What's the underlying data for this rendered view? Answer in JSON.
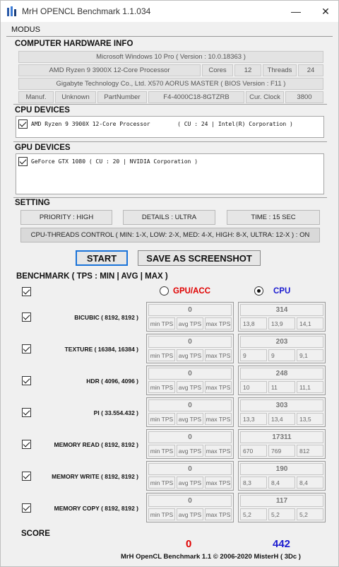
{
  "window": {
    "title": "MrH OPENCL Benchmark 1.1.034",
    "minimize_glyph": "—",
    "close_glyph": "✕"
  },
  "menu": {
    "items": [
      "MODUS"
    ]
  },
  "hardware": {
    "title": "COMPUTER HARDWARE INFO",
    "os": "Microsoft Windows 10 Pro ( Version : 10.0.18363 )",
    "cpu_name": "AMD Ryzen 9 3900X 12-Core Processor",
    "cores_label": "Cores",
    "cores_value": "12",
    "threads_label": "Threads",
    "threads_value": "24",
    "board": "Gigabyte Technology Co., Ltd. X570 AORUS MASTER ( BIOS Version : F11 )",
    "manuf_label": "Manuf.",
    "manuf_value": "Unknown",
    "partnumber_label": "PartNumber",
    "partnumber_value": "F4-4000C18-8GTZRB",
    "clock_label": "Cur. Clock",
    "clock_value": "3800"
  },
  "cpu_devices": {
    "title": "CPU DEVICES",
    "items": [
      "AMD Ryzen 9 3900X 12-Core Processor        ( CU : 24 | Intel(R) Corporation )"
    ]
  },
  "gpu_devices": {
    "title": "GPU DEVICES",
    "items": [
      "GeForce GTX 1080 ( CU : 20 | NVIDIA Corporation )"
    ]
  },
  "setting": {
    "title": "SETTING",
    "priority": "PRIORITY : HIGH",
    "details": "DETAILS : ULTRA",
    "time": "TIME : 15 SEC",
    "cpu_threads": "CPU-THREADS CONTROL ( MIN: 1-X, LOW: 2-X, MED: 4-X, HIGH: 8-X, ULTRA: 12-X ) : ON"
  },
  "actions": {
    "start": "START",
    "screenshot": "SAVE AS SCREENSHOT"
  },
  "benchmark": {
    "title": "BENCHMARK ( TPS : MIN | AVG | MAX )",
    "gpu_label": "GPU/ACC",
    "cpu_label": "CPU",
    "gpu_color": "#e00000",
    "cpu_color": "#1a1ad0",
    "selected_device": "CPU",
    "rows": [
      {
        "name": "BICUBIC ( 8192, 8192 )",
        "gpu": {
          "main": "0",
          "min": "min TPS",
          "avg": "avg TPS",
          "max": "max TPS"
        },
        "cpu": {
          "main": "314",
          "min": "13,8",
          "avg": "13,9",
          "max": "14,1"
        }
      },
      {
        "name": "TEXTURE ( 16384, 16384 )",
        "gpu": {
          "main": "0",
          "min": "min TPS",
          "avg": "avg TPS",
          "max": "max TPS"
        },
        "cpu": {
          "main": "203",
          "min": "9",
          "avg": "9",
          "max": "9,1"
        }
      },
      {
        "name": "HDR ( 4096, 4096 )",
        "gpu": {
          "main": "0",
          "min": "min TPS",
          "avg": "avg TPS",
          "max": "max TPS"
        },
        "cpu": {
          "main": "248",
          "min": "10",
          "avg": "11",
          "max": "11,1"
        }
      },
      {
        "name": "PI ( 33.554.432 )",
        "gpu": {
          "main": "0",
          "min": "min TPS",
          "avg": "avg TPS",
          "max": "max TPS"
        },
        "cpu": {
          "main": "303",
          "min": "13,3",
          "avg": "13,4",
          "max": "13,5"
        }
      },
      {
        "name": "MEMORY READ ( 8192, 8192 )",
        "gpu": {
          "main": "0",
          "min": "min TPS",
          "avg": "avg TPS",
          "max": "max TPS"
        },
        "cpu": {
          "main": "17311",
          "min": "670",
          "avg": "769",
          "max": "812"
        }
      },
      {
        "name": "MEMORY WRITE ( 8192, 8192 )",
        "gpu": {
          "main": "0",
          "min": "min TPS",
          "avg": "avg TPS",
          "max": "max TPS"
        },
        "cpu": {
          "main": "190",
          "min": "8,3",
          "avg": "8,4",
          "max": "8,4"
        }
      },
      {
        "name": "MEMORY COPY ( 8192, 8192 )",
        "gpu": {
          "main": "0",
          "min": "min TPS",
          "avg": "avg TPS",
          "max": "max TPS"
        },
        "cpu": {
          "main": "117",
          "min": "5,2",
          "avg": "5,2",
          "max": "5,2"
        }
      }
    ]
  },
  "score": {
    "title": "SCORE",
    "gpu": "0",
    "cpu": "442"
  },
  "footer": "MrH OpenCL Benchmark 1.1  ©  2006-2020 MisterH ( 3Dc )"
}
